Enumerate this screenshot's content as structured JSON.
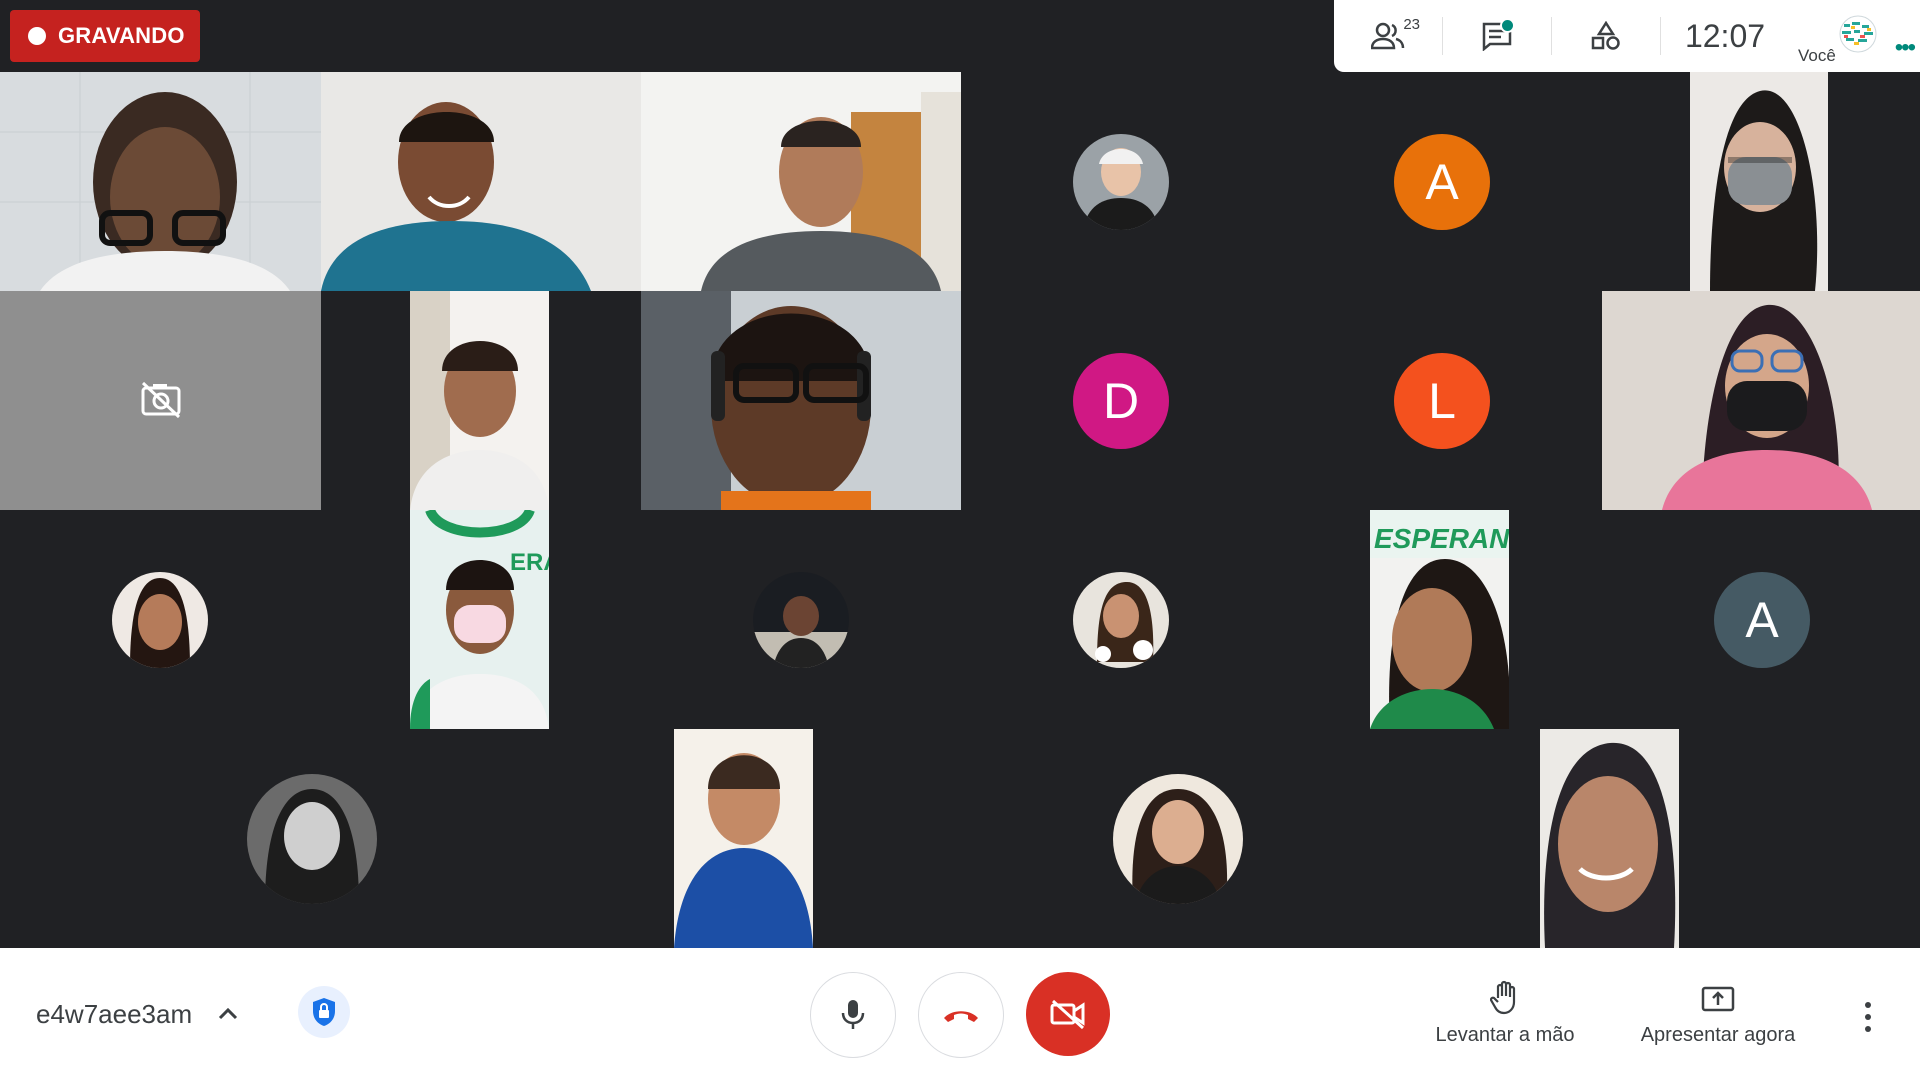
{
  "recording": {
    "label": "GRAVANDO"
  },
  "top_panel": {
    "participants_count": "23",
    "clock": "12:07",
    "self_label": "Você"
  },
  "tiles": [
    {
      "kind": "video",
      "desc": "woman with glasses"
    },
    {
      "kind": "video",
      "desc": "man smiling"
    },
    {
      "kind": "video",
      "desc": "man smiling"
    },
    {
      "kind": "photo"
    },
    {
      "kind": "letter",
      "letter": "A",
      "color": "#e8710a"
    },
    {
      "kind": "video",
      "desc": "woman with mask"
    },
    {
      "kind": "camera-off"
    },
    {
      "kind": "video",
      "desc": "woman smiling"
    },
    {
      "kind": "video",
      "desc": "man with headphones"
    },
    {
      "kind": "letter",
      "letter": "D",
      "color": "#d01884"
    },
    {
      "kind": "letter",
      "letter": "L",
      "color": "#f4511e"
    },
    {
      "kind": "video",
      "desc": "woman with mask"
    },
    {
      "kind": "photo"
    },
    {
      "kind": "video",
      "desc": "woman with mask",
      "banner": "ERA"
    },
    {
      "kind": "photo"
    },
    {
      "kind": "photo"
    },
    {
      "kind": "video",
      "desc": "woman",
      "banner": "ESPERANÇ"
    },
    {
      "kind": "letter",
      "letter": "A",
      "color": "#455a64"
    },
    {
      "kind": "photo"
    },
    {
      "kind": "video",
      "desc": "woman in blue"
    },
    {
      "kind": "photo"
    },
    {
      "kind": "video",
      "desc": "woman smiling"
    }
  ],
  "bottom_bar": {
    "meeting_code": "e4w7aee3am",
    "raise_hand_label": "Levantar a mão",
    "present_label": "Apresentar agora"
  },
  "colors": {
    "background": "#202124",
    "recording": "#c5221f",
    "end_call_red": "#d93025",
    "accent_blue": "#1a73e8",
    "teal": "#00897b"
  },
  "icons": [
    "record-dot-icon",
    "participants-icon",
    "chat-icon",
    "activities-icon",
    "camera-off-icon",
    "chevron-up-icon",
    "shield-lock-icon",
    "mic-icon",
    "hangup-icon",
    "video-off-icon",
    "raise-hand-icon",
    "present-icon",
    "more-vert-icon"
  ]
}
